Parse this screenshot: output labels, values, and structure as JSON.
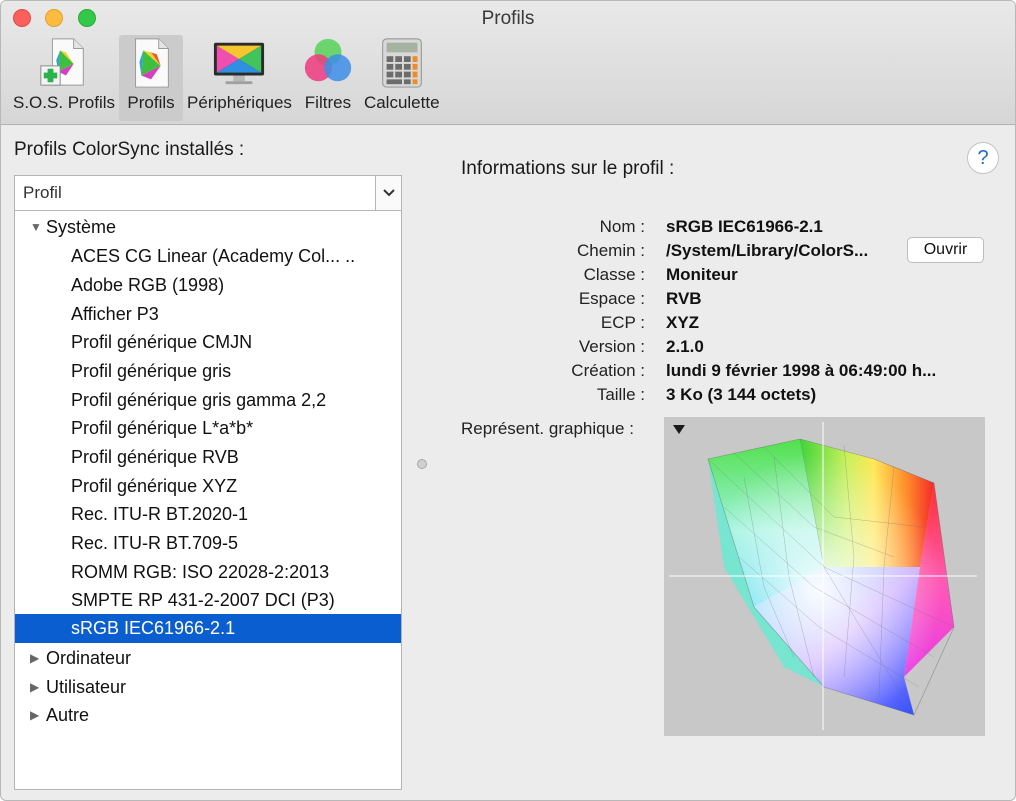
{
  "window": {
    "title": "Profils"
  },
  "toolbar": {
    "items": [
      {
        "label": "S.O.S. Profils",
        "icon": "first-aid-profile-icon"
      },
      {
        "label": "Profils",
        "icon": "profile-document-icon",
        "selected": true
      },
      {
        "label": "Périphériques",
        "icon": "display-icon"
      },
      {
        "label": "Filtres",
        "icon": "color-circles-icon"
      },
      {
        "label": "Calculette",
        "icon": "calculator-icon"
      }
    ]
  },
  "left": {
    "title": "Profils ColorSync installés :",
    "popup_value": "Profil",
    "groups": [
      {
        "label": "Système",
        "expanded": true,
        "items": [
          "ACES CG Linear (Academy Col... ..",
          "Adobe RGB (1998)",
          "Afficher P3",
          "Profil générique CMJN",
          "Profil générique gris",
          "Profil générique gris gamma 2,2",
          "Profil générique L*a*b*",
          "Profil générique RVB",
          "Profil générique XYZ",
          "Rec. ITU-R BT.2020-1",
          "Rec. ITU-R BT.709-5",
          "ROMM RGB: ISO 22028-2:2013",
          "SMPTE RP 431-2-2007 DCI (P3)",
          "sRGB IEC61966-2.1"
        ],
        "selected_index": 13
      },
      {
        "label": "Ordinateur",
        "expanded": false
      },
      {
        "label": "Utilisateur",
        "expanded": false
      },
      {
        "label": "Autre",
        "expanded": false
      }
    ]
  },
  "info": {
    "title": "Informations sur le profil :",
    "help": "?",
    "rows": [
      {
        "label": "Nom :",
        "value": "sRGB IEC61966-2.1"
      },
      {
        "label": "Chemin :",
        "value": "/System/Library/ColorS..."
      },
      {
        "label": "Classe :",
        "value": "Moniteur"
      },
      {
        "label": "Espace :",
        "value": "RVB"
      },
      {
        "label": "ECP :",
        "value": "XYZ"
      },
      {
        "label": "Version :",
        "value": "2.1.0"
      },
      {
        "label": "Création :",
        "value": "lundi 9 février 1998 à 06:49:00 h..."
      },
      {
        "label": "Taille :",
        "value": "3 Ko (3 144 octets)"
      }
    ],
    "open_button": "Ouvrir",
    "graph_label": "Représent. graphique :"
  },
  "colors": {
    "selection": "#0a5ecf",
    "help_text": "#1f6cd1",
    "graph_background": "#c8c8c8"
  }
}
